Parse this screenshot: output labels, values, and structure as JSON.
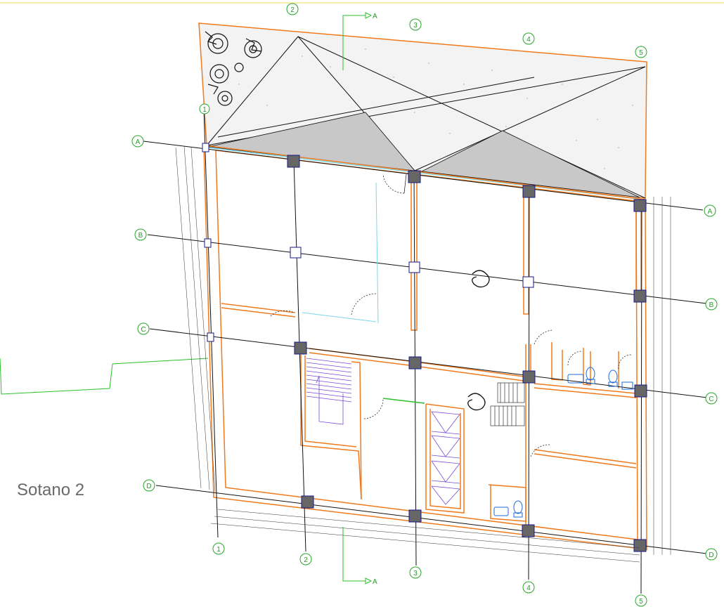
{
  "drawing": {
    "sheet_label": "Sotano 2",
    "section_marker": "A",
    "column_axes": [
      "1",
      "2",
      "3",
      "4",
      "5"
    ],
    "row_axes": [
      "A",
      "B",
      "C",
      "D"
    ],
    "colors": {
      "walls": "#f07a1e",
      "grid_lines": "#111111",
      "axis_bubbles": "#2aa52a",
      "columns": "#1a1a8a",
      "fixtures": "#1e6ad6",
      "stairs": "#7a4ad6",
      "skylight": "#c8c8c8",
      "dimensions": "#8a7a00"
    }
  }
}
